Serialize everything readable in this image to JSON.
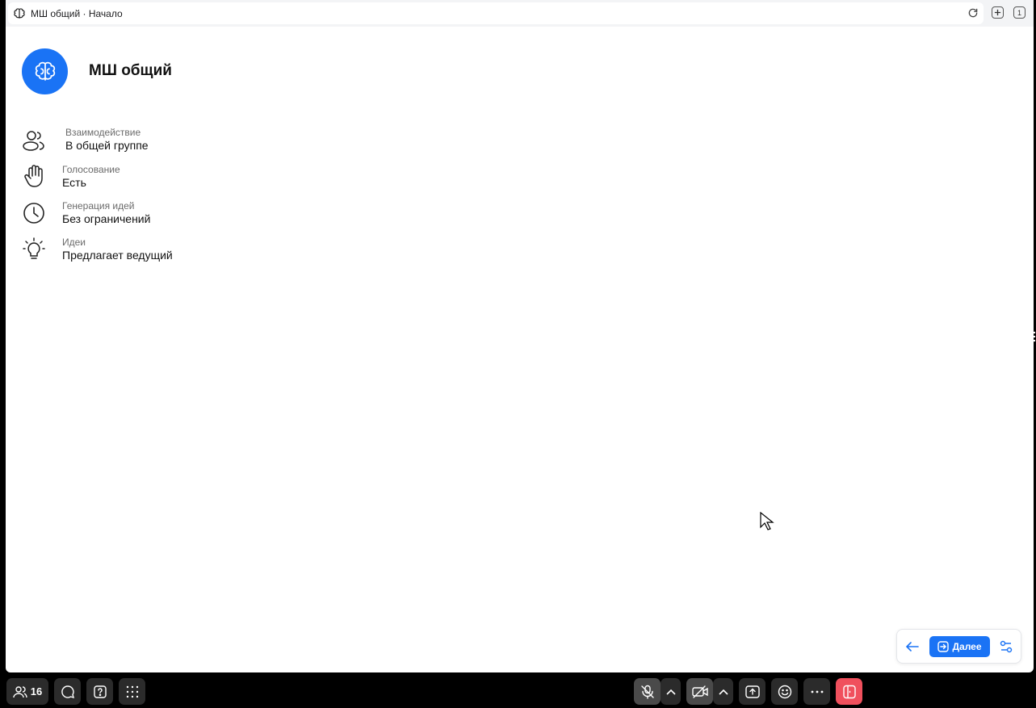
{
  "tab": {
    "title": "МШ общий · Начало",
    "tabs_count": "1"
  },
  "room": {
    "title": "МШ общий"
  },
  "info": [
    {
      "icon": "users-icon",
      "label": "Взаимодействие",
      "value": "В общей группе"
    },
    {
      "icon": "hand-icon",
      "label": "Голосование",
      "value": "Есть"
    },
    {
      "icon": "clock-icon",
      "label": "Генерация идей",
      "value": "Без ограничений"
    },
    {
      "icon": "lightbulb-icon",
      "label": "Идеи",
      "value": "Предлагает ведущий"
    }
  ],
  "nav": {
    "next_label": "Далее"
  },
  "toolbar": {
    "participants_count": "16"
  },
  "colors": {
    "accent": "#1a73f5",
    "leave": "#f0505d",
    "toolbar_bg": "#2b2b2b"
  }
}
